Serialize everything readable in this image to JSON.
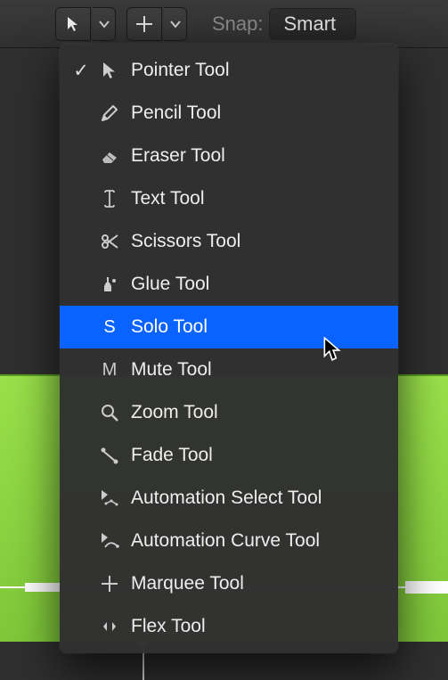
{
  "toolbar": {
    "snap_label": "Snap:",
    "snap_value": "Smart"
  },
  "menu": {
    "items": [
      {
        "label": "Pointer Tool",
        "icon": "pointer",
        "checked": true
      },
      {
        "label": "Pencil Tool",
        "icon": "pencil",
        "checked": false
      },
      {
        "label": "Eraser Tool",
        "icon": "eraser",
        "checked": false
      },
      {
        "label": "Text Tool",
        "icon": "text",
        "checked": false
      },
      {
        "label": "Scissors Tool",
        "icon": "scissors",
        "checked": false
      },
      {
        "label": "Glue Tool",
        "icon": "glue",
        "checked": false
      },
      {
        "label": "Solo Tool",
        "icon": "letter-S",
        "checked": false,
        "highlight": true
      },
      {
        "label": "Mute Tool",
        "icon": "letter-M",
        "checked": false
      },
      {
        "label": "Zoom Tool",
        "icon": "zoom",
        "checked": false
      },
      {
        "label": "Fade Tool",
        "icon": "fade",
        "checked": false
      },
      {
        "label": "Automation Select Tool",
        "icon": "autoselect",
        "checked": false
      },
      {
        "label": "Automation Curve Tool",
        "icon": "autocurve",
        "checked": false
      },
      {
        "label": "Marquee Tool",
        "icon": "marquee",
        "checked": false
      },
      {
        "label": "Flex Tool",
        "icon": "flex",
        "checked": false
      }
    ]
  }
}
